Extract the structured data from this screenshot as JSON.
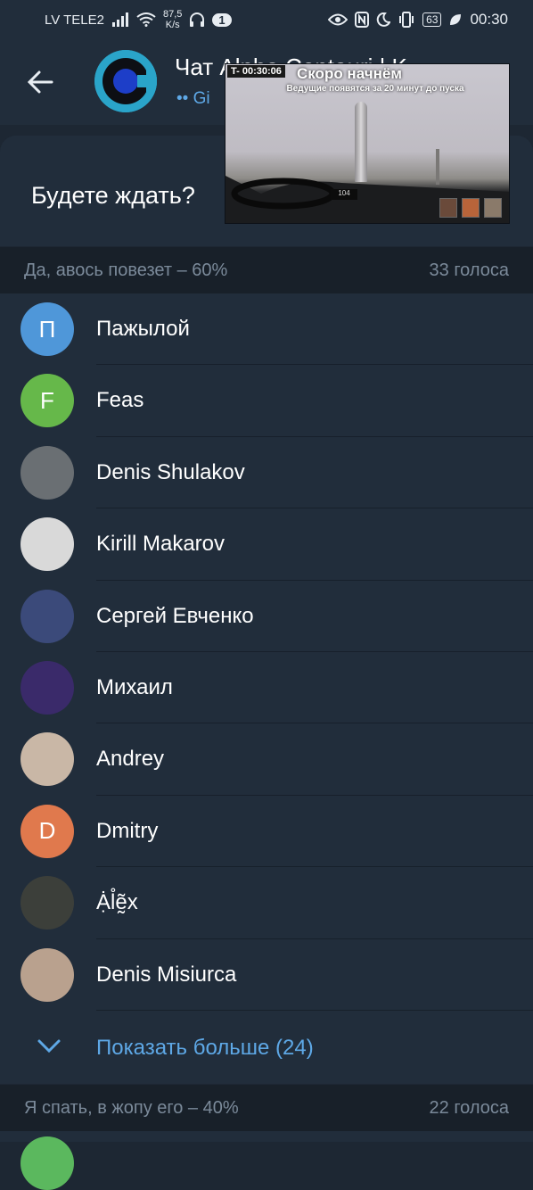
{
  "status_bar": {
    "carrier": "LV TELE2",
    "speed_value": "87,5",
    "speed_unit": "K/s",
    "notif_count": "1",
    "battery": "63",
    "time": "00:30"
  },
  "header": {
    "title": "Чат Alpha Centauri | K",
    "subtitle": "•• Gi"
  },
  "pip_video": {
    "timer": "T- 00:30:06",
    "title": "Скоро начнём",
    "subtitle": "Ведущие появятся за 20 минут до пуска",
    "dashboard_readout": "104"
  },
  "poll": {
    "question": "Будете ждать?",
    "options": [
      {
        "label": "Да, авось повезет – 60%",
        "votes": "33 голоса",
        "voters": [
          {
            "initial": "П",
            "name": "Пажылой",
            "color": "#4f97d9"
          },
          {
            "initial": "F",
            "name": "Feas",
            "color": "#66b84a"
          },
          {
            "initial": "",
            "name": "Denis Shulakov",
            "color": "#6a6f73"
          },
          {
            "initial": "",
            "name": "Kirill Makarov",
            "color": "#d9d9d9"
          },
          {
            "initial": "",
            "name": "Сергей Евченко",
            "color": "#3b4a7a"
          },
          {
            "initial": "",
            "name": "Михаил",
            "color": "#3a2a6a"
          },
          {
            "initial": "",
            "name": "Andrey",
            "color": "#c9b7a6"
          },
          {
            "initial": "D",
            "name": "Dmitry",
            "color": "#e0794d"
          },
          {
            "initial": "",
            "name": "Ạ̇l̊ḛ̃x",
            "color": "#3c3f3a"
          },
          {
            "initial": "",
            "name": "Denis Misiurca",
            "color": "#b9a18e"
          }
        ],
        "show_more": "Показать больше (24)"
      },
      {
        "label": "Я спать, в жопу его – 40%",
        "votes": "22 голоса"
      }
    ]
  }
}
